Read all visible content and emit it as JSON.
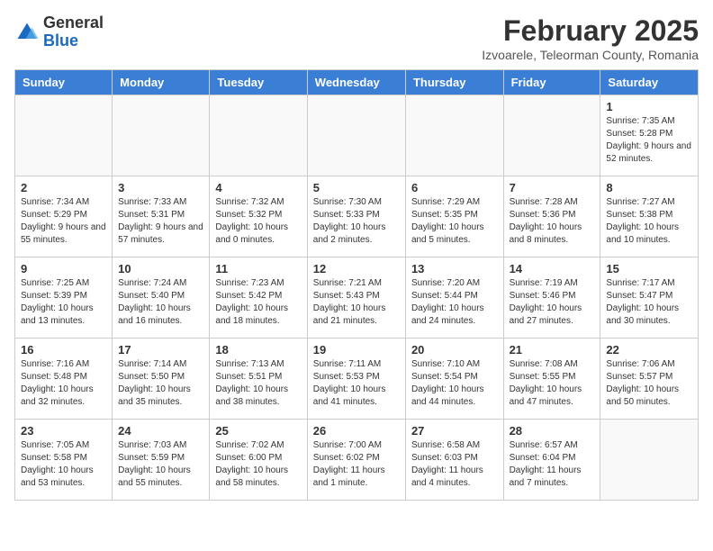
{
  "logo": {
    "general": "General",
    "blue": "Blue"
  },
  "title": "February 2025",
  "subtitle": "Izvoarele, Teleorman County, Romania",
  "days_of_week": [
    "Sunday",
    "Monday",
    "Tuesday",
    "Wednesday",
    "Thursday",
    "Friday",
    "Saturday"
  ],
  "weeks": [
    [
      {
        "day": "",
        "info": ""
      },
      {
        "day": "",
        "info": ""
      },
      {
        "day": "",
        "info": ""
      },
      {
        "day": "",
        "info": ""
      },
      {
        "day": "",
        "info": ""
      },
      {
        "day": "",
        "info": ""
      },
      {
        "day": "1",
        "info": "Sunrise: 7:35 AM\nSunset: 5:28 PM\nDaylight: 9 hours and 52 minutes."
      }
    ],
    [
      {
        "day": "2",
        "info": "Sunrise: 7:34 AM\nSunset: 5:29 PM\nDaylight: 9 hours and 55 minutes."
      },
      {
        "day": "3",
        "info": "Sunrise: 7:33 AM\nSunset: 5:31 PM\nDaylight: 9 hours and 57 minutes."
      },
      {
        "day": "4",
        "info": "Sunrise: 7:32 AM\nSunset: 5:32 PM\nDaylight: 10 hours and 0 minutes."
      },
      {
        "day": "5",
        "info": "Sunrise: 7:30 AM\nSunset: 5:33 PM\nDaylight: 10 hours and 2 minutes."
      },
      {
        "day": "6",
        "info": "Sunrise: 7:29 AM\nSunset: 5:35 PM\nDaylight: 10 hours and 5 minutes."
      },
      {
        "day": "7",
        "info": "Sunrise: 7:28 AM\nSunset: 5:36 PM\nDaylight: 10 hours and 8 minutes."
      },
      {
        "day": "8",
        "info": "Sunrise: 7:27 AM\nSunset: 5:38 PM\nDaylight: 10 hours and 10 minutes."
      }
    ],
    [
      {
        "day": "9",
        "info": "Sunrise: 7:25 AM\nSunset: 5:39 PM\nDaylight: 10 hours and 13 minutes."
      },
      {
        "day": "10",
        "info": "Sunrise: 7:24 AM\nSunset: 5:40 PM\nDaylight: 10 hours and 16 minutes."
      },
      {
        "day": "11",
        "info": "Sunrise: 7:23 AM\nSunset: 5:42 PM\nDaylight: 10 hours and 18 minutes."
      },
      {
        "day": "12",
        "info": "Sunrise: 7:21 AM\nSunset: 5:43 PM\nDaylight: 10 hours and 21 minutes."
      },
      {
        "day": "13",
        "info": "Sunrise: 7:20 AM\nSunset: 5:44 PM\nDaylight: 10 hours and 24 minutes."
      },
      {
        "day": "14",
        "info": "Sunrise: 7:19 AM\nSunset: 5:46 PM\nDaylight: 10 hours and 27 minutes."
      },
      {
        "day": "15",
        "info": "Sunrise: 7:17 AM\nSunset: 5:47 PM\nDaylight: 10 hours and 30 minutes."
      }
    ],
    [
      {
        "day": "16",
        "info": "Sunrise: 7:16 AM\nSunset: 5:48 PM\nDaylight: 10 hours and 32 minutes."
      },
      {
        "day": "17",
        "info": "Sunrise: 7:14 AM\nSunset: 5:50 PM\nDaylight: 10 hours and 35 minutes."
      },
      {
        "day": "18",
        "info": "Sunrise: 7:13 AM\nSunset: 5:51 PM\nDaylight: 10 hours and 38 minutes."
      },
      {
        "day": "19",
        "info": "Sunrise: 7:11 AM\nSunset: 5:53 PM\nDaylight: 10 hours and 41 minutes."
      },
      {
        "day": "20",
        "info": "Sunrise: 7:10 AM\nSunset: 5:54 PM\nDaylight: 10 hours and 44 minutes."
      },
      {
        "day": "21",
        "info": "Sunrise: 7:08 AM\nSunset: 5:55 PM\nDaylight: 10 hours and 47 minutes."
      },
      {
        "day": "22",
        "info": "Sunrise: 7:06 AM\nSunset: 5:57 PM\nDaylight: 10 hours and 50 minutes."
      }
    ],
    [
      {
        "day": "23",
        "info": "Sunrise: 7:05 AM\nSunset: 5:58 PM\nDaylight: 10 hours and 53 minutes."
      },
      {
        "day": "24",
        "info": "Sunrise: 7:03 AM\nSunset: 5:59 PM\nDaylight: 10 hours and 55 minutes."
      },
      {
        "day": "25",
        "info": "Sunrise: 7:02 AM\nSunset: 6:00 PM\nDaylight: 10 hours and 58 minutes."
      },
      {
        "day": "26",
        "info": "Sunrise: 7:00 AM\nSunset: 6:02 PM\nDaylight: 11 hours and 1 minute."
      },
      {
        "day": "27",
        "info": "Sunrise: 6:58 AM\nSunset: 6:03 PM\nDaylight: 11 hours and 4 minutes."
      },
      {
        "day": "28",
        "info": "Sunrise: 6:57 AM\nSunset: 6:04 PM\nDaylight: 11 hours and 7 minutes."
      },
      {
        "day": "",
        "info": ""
      }
    ]
  ]
}
